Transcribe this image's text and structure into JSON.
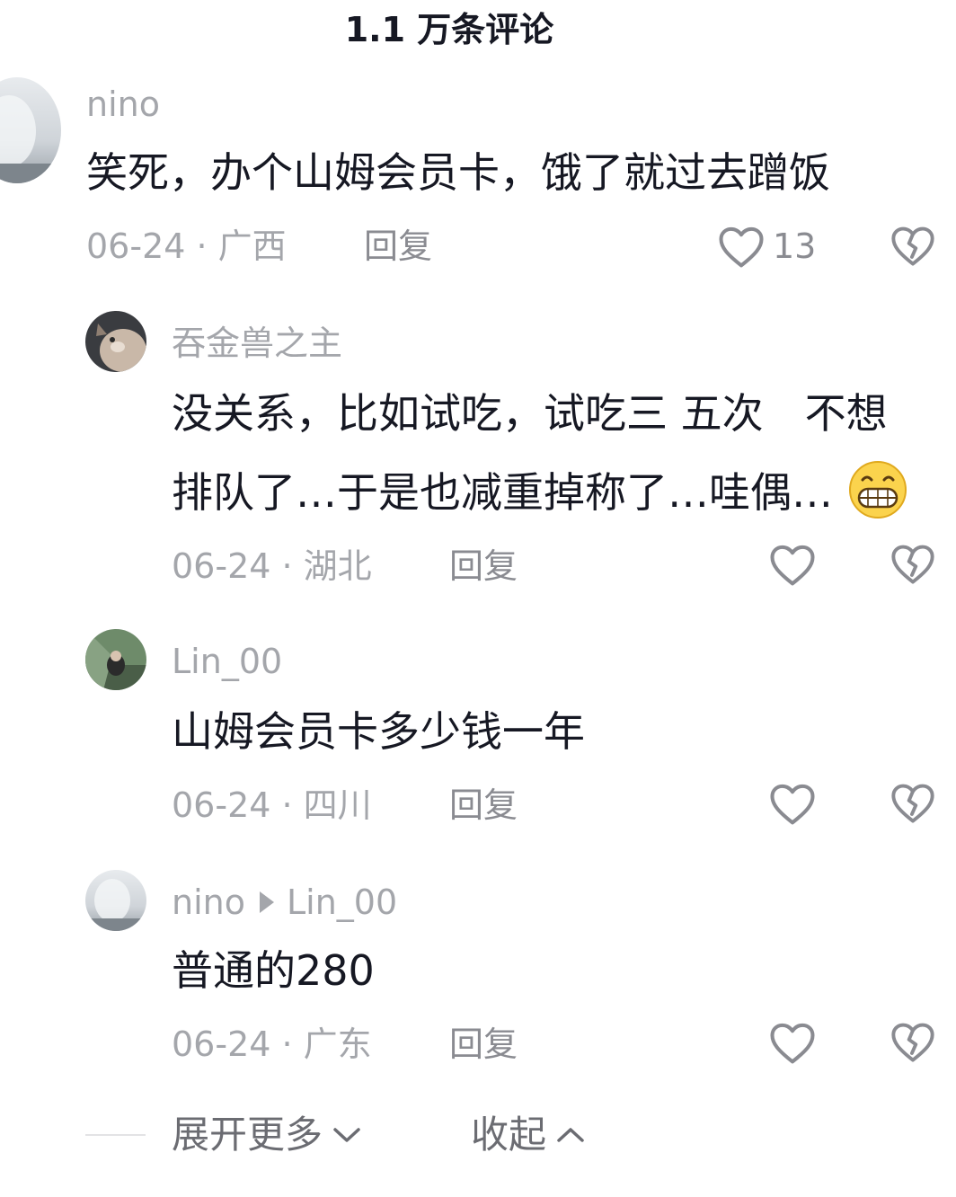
{
  "header": {
    "title": "1.1 万条评论"
  },
  "comments": [
    {
      "username": "nino",
      "text_lines": [
        "笑死，办个山姆会员卡，饿了就过去蹭饭"
      ],
      "date": "06-24",
      "location": "广西",
      "date_location": "06-24 · 广西",
      "reply_label": "回复",
      "like_count": "13",
      "avatar_icon": "avatar-misty-landscape"
    },
    {
      "username": "吞金兽之主",
      "text_lines": [
        "没关系，比如试吃，试吃三 五次　不想",
        "排队了…于是也减重掉称了…哇偶…"
      ],
      "emoji": "grinning-face-emoji",
      "date_location": "06-24 · 湖北",
      "reply_label": "回复",
      "like_count": "",
      "avatar_icon": "avatar-cat"
    },
    {
      "username": "Lin_00",
      "text_lines": [
        "山姆会员卡多少钱一年"
      ],
      "date_location": "06-24 · 四川",
      "reply_label": "回复",
      "like_count": "",
      "avatar_icon": "avatar-person-outdoors"
    },
    {
      "username": "nino",
      "reply_to": "Lin_00",
      "text_lines": [
        "普通的280"
      ],
      "date_location": "06-24 · 广东",
      "reply_label": "回复",
      "like_count": "",
      "avatar_icon": "avatar-misty-landscape"
    }
  ],
  "footer": {
    "expand_label": "展开更多",
    "collapse_label": "收起"
  },
  "colors": {
    "text_primary": "#161823",
    "text_secondary": "#a4a6ab",
    "icon_gray": "#8a8b91"
  }
}
